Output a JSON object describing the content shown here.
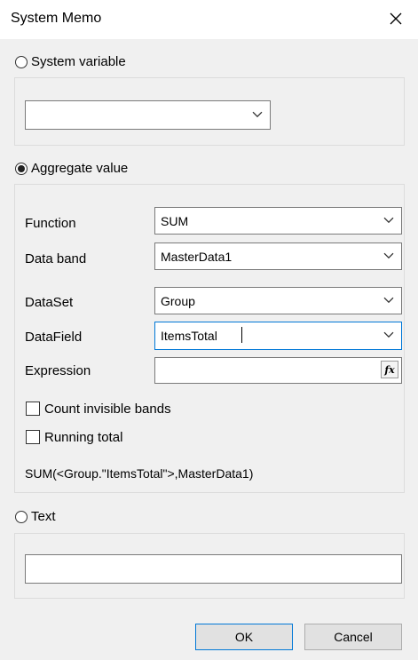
{
  "window": {
    "title": "System Memo"
  },
  "system_variable": {
    "label": "System variable",
    "selected": false,
    "value": ""
  },
  "aggregate": {
    "label": "Aggregate value",
    "selected": true,
    "function_label": "Function",
    "function_value": "SUM",
    "databand_label": "Data band",
    "databand_value": "MasterData1",
    "dataset_label": "DataSet",
    "dataset_value": "Group",
    "datafield_label": "DataField",
    "datafield_value": "ItemsTotal",
    "expression_label": "Expression",
    "expression_value": "",
    "fx_label": "fx",
    "count_invisible_label": "Count invisible bands",
    "count_invisible_checked": false,
    "running_total_label": "Running total",
    "running_total_checked": false,
    "result": "SUM(<Group.\"ItemsTotal\">,MasterData1)"
  },
  "text_option": {
    "label": "Text",
    "selected": false,
    "value": ""
  },
  "buttons": {
    "ok": "OK",
    "cancel": "Cancel"
  },
  "icons": {
    "close": "close-icon",
    "dropdown": "chevron-down-icon",
    "function": "fx-icon"
  },
  "colors": {
    "focus": "#0078d7",
    "panel": "#f0f0f0",
    "titlebar": "#ffffff"
  }
}
